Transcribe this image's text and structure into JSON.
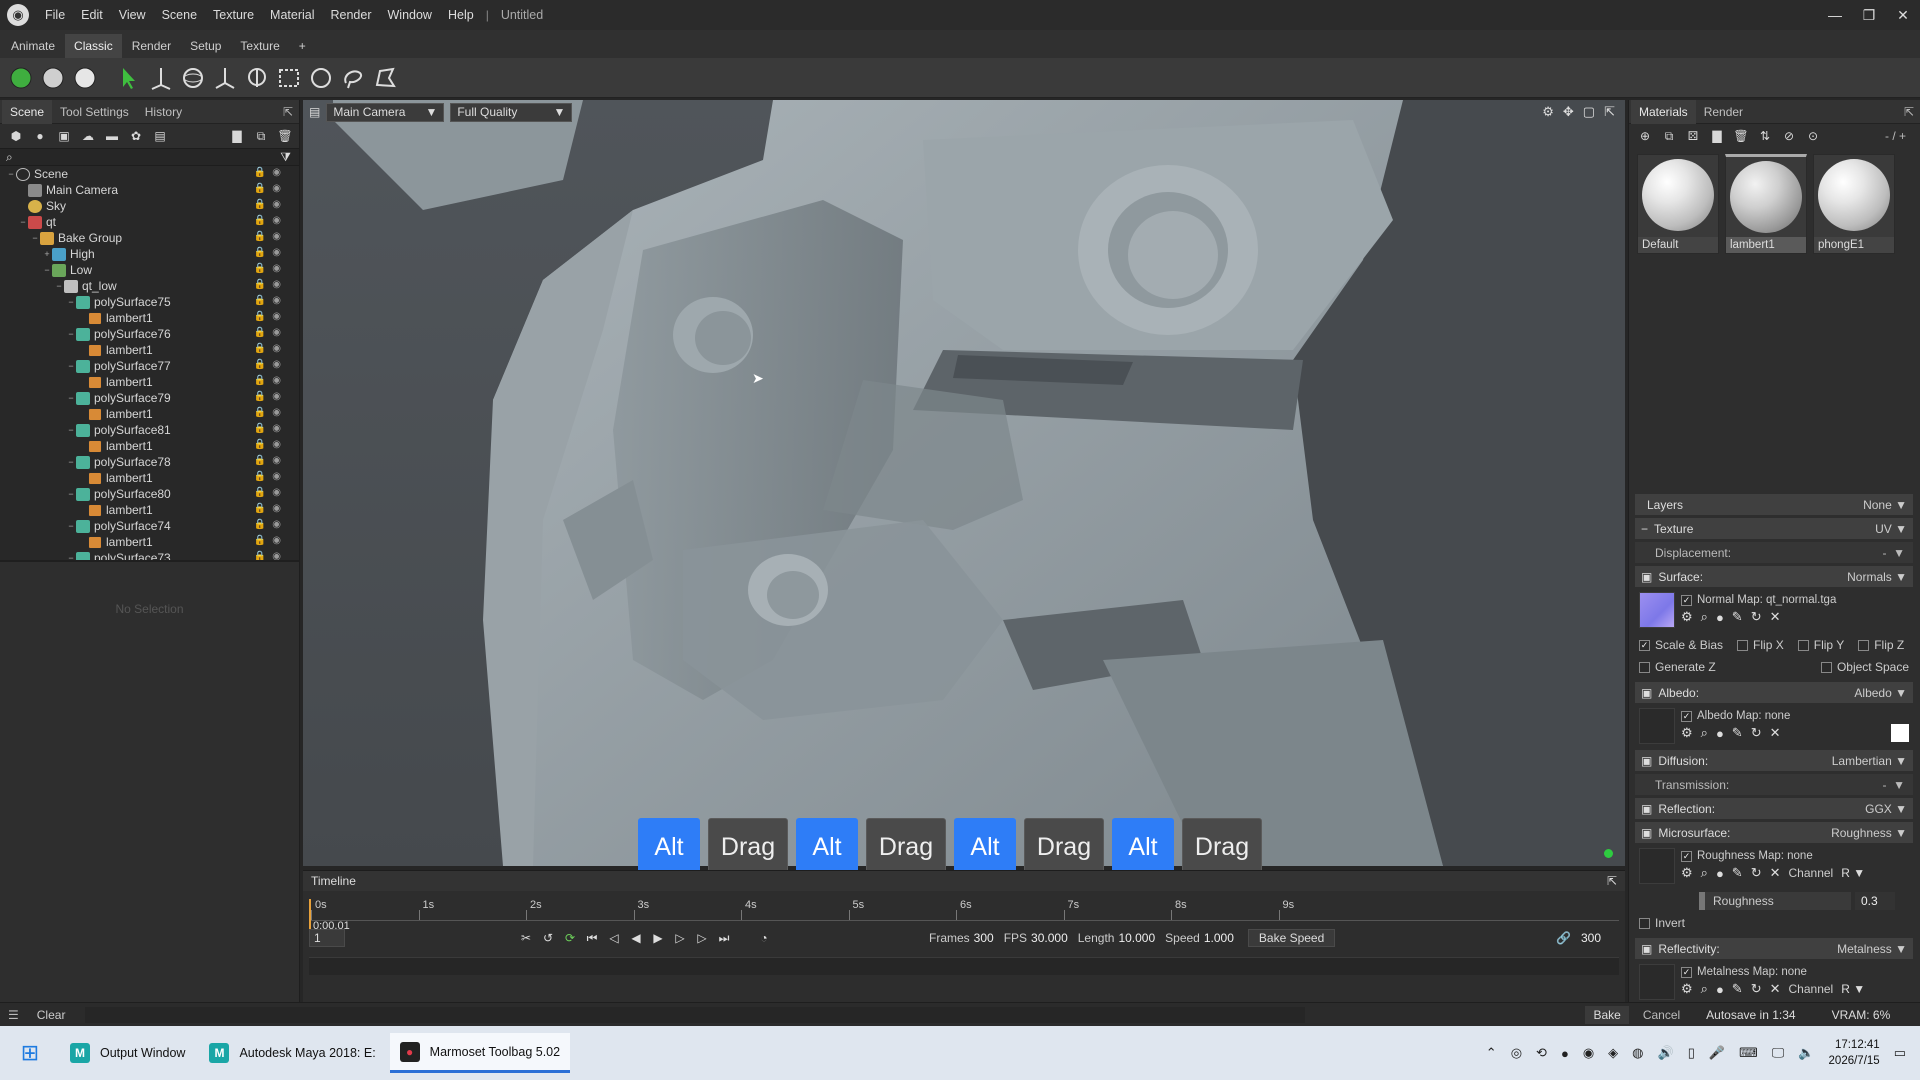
{
  "titlebar": {
    "menus": [
      "File",
      "Edit",
      "View",
      "Scene",
      "Texture",
      "Material",
      "Render",
      "Window",
      "Help"
    ],
    "document": "Untitled"
  },
  "workspace_tabs": [
    "Animate",
    "Classic",
    "Render",
    "Setup",
    "Texture",
    "+"
  ],
  "left_panel": {
    "tabs": [
      "Scene",
      "Tool Settings",
      "History"
    ],
    "no_selection": "No Selection",
    "tree": [
      {
        "label": "Scene",
        "depth": 0,
        "icon": "scene",
        "exp": "−"
      },
      {
        "label": "Main Camera",
        "depth": 1,
        "icon": "cam",
        "exp": ""
      },
      {
        "label": "Sky",
        "depth": 1,
        "icon": "sky",
        "exp": ""
      },
      {
        "label": "qt",
        "depth": 1,
        "icon": "obj",
        "exp": "−"
      },
      {
        "label": "Bake Group",
        "depth": 2,
        "icon": "folder",
        "exp": "−"
      },
      {
        "label": "High",
        "depth": 3,
        "icon": "high",
        "exp": "+"
      },
      {
        "label": "Low",
        "depth": 3,
        "icon": "low",
        "exp": "−"
      },
      {
        "label": "qt_low",
        "depth": 4,
        "icon": "qt",
        "exp": "−"
      },
      {
        "label": "polySurface75",
        "depth": 5,
        "icon": "mesh",
        "exp": "−"
      },
      {
        "label": "lambert1",
        "depth": 6,
        "icon": "mat",
        "exp": ""
      },
      {
        "label": "polySurface76",
        "depth": 5,
        "icon": "mesh",
        "exp": "−"
      },
      {
        "label": "lambert1",
        "depth": 6,
        "icon": "mat",
        "exp": ""
      },
      {
        "label": "polySurface77",
        "depth": 5,
        "icon": "mesh",
        "exp": "−"
      },
      {
        "label": "lambert1",
        "depth": 6,
        "icon": "mat",
        "exp": ""
      },
      {
        "label": "polySurface79",
        "depth": 5,
        "icon": "mesh",
        "exp": "−"
      },
      {
        "label": "lambert1",
        "depth": 6,
        "icon": "mat",
        "exp": ""
      },
      {
        "label": "polySurface81",
        "depth": 5,
        "icon": "mesh",
        "exp": "−"
      },
      {
        "label": "lambert1",
        "depth": 6,
        "icon": "mat",
        "exp": ""
      },
      {
        "label": "polySurface78",
        "depth": 5,
        "icon": "mesh",
        "exp": "−"
      },
      {
        "label": "lambert1",
        "depth": 6,
        "icon": "mat",
        "exp": ""
      },
      {
        "label": "polySurface80",
        "depth": 5,
        "icon": "mesh",
        "exp": "−"
      },
      {
        "label": "lambert1",
        "depth": 6,
        "icon": "mat",
        "exp": ""
      },
      {
        "label": "polySurface74",
        "depth": 5,
        "icon": "mesh",
        "exp": "−"
      },
      {
        "label": "lambert1",
        "depth": 6,
        "icon": "mat",
        "exp": ""
      },
      {
        "label": "polySurface73",
        "depth": 5,
        "icon": "mesh",
        "exp": "−"
      }
    ]
  },
  "viewport": {
    "camera": "Main Camera",
    "quality": "Full Quality",
    "keys": [
      "Alt",
      "Drag",
      "Alt",
      "Drag",
      "Alt",
      "Drag",
      "Alt",
      "Drag"
    ]
  },
  "timeline": {
    "title": "Timeline",
    "ticks": [
      "0s",
      "1s",
      "2s",
      "3s",
      "4s",
      "5s",
      "6s",
      "7s",
      "8s",
      "9s"
    ],
    "current_time": "0:00.01",
    "frame": "1",
    "frames_label": "Frames",
    "frames": "300",
    "fps_label": "FPS",
    "fps": "30.000",
    "length_label": "Length",
    "length": "10.000",
    "speed_label": "Speed",
    "speed": "1.000",
    "bake_speed": "Bake Speed",
    "end_frame": "300"
  },
  "right_panel": {
    "tabs": [
      "Materials",
      "Render"
    ],
    "counter": "- / +",
    "materials": [
      "Default",
      "lambert1",
      "phongE1"
    ],
    "layers": {
      "label": "Layers",
      "value": "None"
    },
    "texture": {
      "label": "Texture",
      "value": "UV"
    },
    "displacement": {
      "label": "Displacement:",
      "value": "-"
    },
    "surface": {
      "label": "Surface:",
      "value": "Normals"
    },
    "normal_map": "Normal Map: qt_normal.tga",
    "scale_bias": "Scale & Bias",
    "flip_x": "Flip X",
    "flip_y": "Flip Y",
    "flip_z": "Flip Z",
    "generate_z": "Generate Z",
    "object_space": "Object Space",
    "albedo": {
      "label": "Albedo:",
      "value": "Albedo"
    },
    "albedo_map": "Albedo Map: none",
    "diffusion": {
      "label": "Diffusion:",
      "value": "Lambertian"
    },
    "transmission": {
      "label": "Transmission:",
      "value": "-"
    },
    "reflection": {
      "label": "Reflection:",
      "value": "GGX"
    },
    "microsurface": {
      "label": "Microsurface:",
      "value": "Roughness"
    },
    "roughness_map": "Roughness Map: none",
    "channel_label": "Channel",
    "channel": "R",
    "roughness_label": "Roughness",
    "roughness": "0.3",
    "invert": "Invert",
    "reflectivity": {
      "label": "Reflectivity:",
      "value": "Metalness"
    },
    "metalness_map": "Metalness Map: none"
  },
  "statusbar": {
    "clear": "Clear",
    "bake": "Bake",
    "cancel": "Cancel",
    "autosave": "Autosave in 1:34",
    "vram": "VRAM: 6%"
  },
  "taskbar": {
    "apps": [
      {
        "label": "Output Window",
        "icon": "M"
      },
      {
        "label": "Autodesk Maya 2018: E:",
        "icon": "M"
      },
      {
        "label": "Marmoset Toolbag 5.02",
        "icon": "●"
      }
    ],
    "time": "17:12:41",
    "date": "2026/7/15"
  },
  "colors": {
    "accent": "#2e7df7",
    "viewport_bg": "#4d5257"
  }
}
